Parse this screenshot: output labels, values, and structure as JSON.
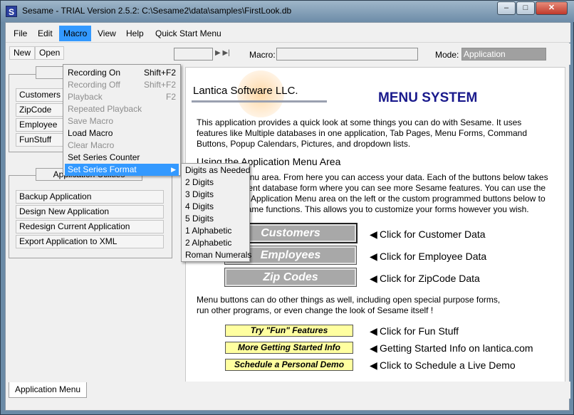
{
  "window": {
    "title": "Sesame - TRIAL Version 2.5.2: C:\\Sesame2\\data\\samples\\FirstLook.db",
    "app_icon": "S",
    "controls": {
      "minimize": "–",
      "maximize": "□",
      "close": "✕"
    }
  },
  "menubar": {
    "items": [
      "File",
      "Edit",
      "Macro",
      "View",
      "Help",
      "Quick Start Menu"
    ],
    "active": "Macro"
  },
  "toolbar": {
    "new_label": "New",
    "open_label": "Open",
    "nav_icons": "▶ ▶|",
    "macro_label": "Macro:",
    "macro_value": "",
    "mode_label": "Mode:",
    "mode_value": "Application"
  },
  "left_panel": {
    "forms_group_title": "A F",
    "forms_buttons": [
      "Customers",
      "ZipCode",
      "Employee",
      "FunStuff"
    ],
    "utilities_title": "Application Utilities",
    "utilities_buttons": [
      "Backup Application",
      "Design New Application",
      "Redesign Current Application",
      "Export Application to XML"
    ]
  },
  "macro_menu": {
    "items": [
      {
        "label": "Recording On",
        "shortcut": "Shift+F2",
        "enabled": true
      },
      {
        "label": "Recording Off",
        "shortcut": "Shift+F2",
        "enabled": false
      },
      {
        "label": "Playback",
        "shortcut": "F2",
        "enabled": false
      },
      {
        "label": "Repeated Playback",
        "shortcut": "",
        "enabled": false
      },
      {
        "label": "Save Macro",
        "shortcut": "",
        "enabled": false
      },
      {
        "label": "Load Macro",
        "shortcut": "",
        "enabled": true
      },
      {
        "label": "Clear Macro",
        "shortcut": "",
        "enabled": false
      },
      {
        "label": "Set Series Counter",
        "shortcut": "",
        "enabled": true
      },
      {
        "label": "Set Series Format",
        "shortcut": "▶",
        "enabled": true
      }
    ],
    "highlighted": "Set Series Format"
  },
  "series_format_submenu": {
    "items": [
      "Digits as Needed",
      "2 Digits",
      "3 Digits",
      "4 Digits",
      "5 Digits",
      "1 Alphabetic",
      "2 Alphabetic",
      "Roman Numerals"
    ]
  },
  "content": {
    "logo_text": "Lantica Software LLC.",
    "heading": "MENU SYSTEM",
    "intro": "This application provides a quick look at some things you can do with Sesame. It uses features like Multiple databases in one application, Tab Pages, Menu Forms, Command Buttons, Popup Calendars, Pictures, and dropdown lists.",
    "section_title": "Using the Application Menu Area",
    "section_text": "This is the menu area. From here you can access your data. Each of the buttons below takes you to a different database form where you can see more Sesame features. You can use the Buttons in the Application Menu area on the left or the custom programmed buttons below to perform the same functions. This allows you to customize your forms however you wish.",
    "big_buttons": [
      {
        "label": "Customers",
        "desc": "Click for Customer Data"
      },
      {
        "label": "Employees",
        "desc": "Click for Employee Data"
      },
      {
        "label": "Zip Codes",
        "desc": "Click for ZipCode Data"
      }
    ],
    "other_text": "Menu buttons can do other things as well, including open special purpose forms, run other programs, or even change the look of Sesame itself !",
    "small_buttons": [
      {
        "label": "Try \"Fun\" Features",
        "desc": "Click for Fun Stuff"
      },
      {
        "label": "More Getting Started Info",
        "desc": "Getting Started Info on lantica.com"
      },
      {
        "label": "Schedule a Personal Demo",
        "desc": "Click to Schedule a Live Demo"
      }
    ],
    "arrow_glyph": "◀"
  },
  "tabs": {
    "active": "Application Menu"
  },
  "colors": {
    "menu_highlight": "#3399ff",
    "heading": "#1a1a8c",
    "yellow_button": "#ffffa0",
    "gray_button": "#a8a8a8"
  }
}
